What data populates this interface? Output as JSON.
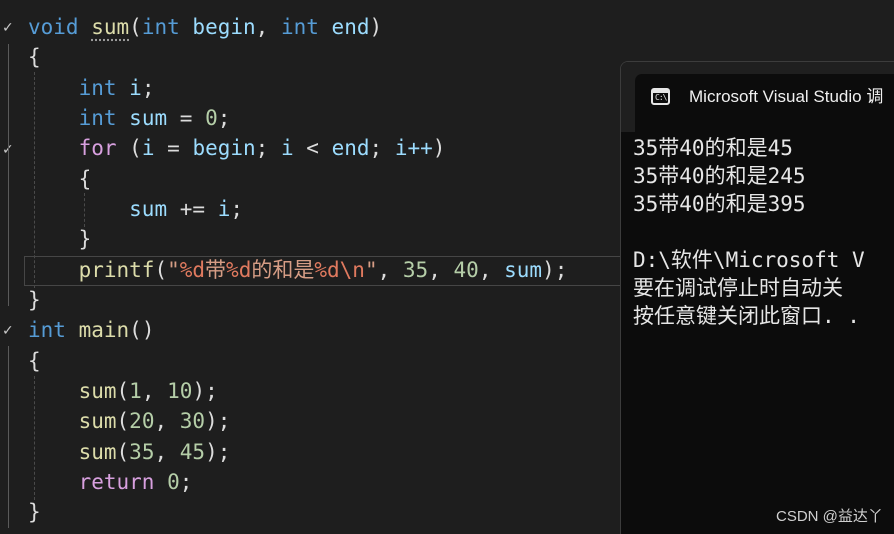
{
  "editor": {
    "lines": [
      {
        "t": "void sum(int begin, int end)"
      },
      {
        "t": "{"
      },
      {
        "t": "    int i;"
      },
      {
        "t": "    int sum = 0;"
      },
      {
        "t": "    for (i = begin; i < end; i++)"
      },
      {
        "t": "    {"
      },
      {
        "t": "        sum += i;"
      },
      {
        "t": "    }"
      },
      {
        "t": "    printf(\"%d带%d的和是%d\\n\", 35, 40, sum);"
      },
      {
        "t": "}"
      },
      {
        "t": "int main()"
      },
      {
        "t": "{"
      },
      {
        "t": "    sum(1, 10);"
      },
      {
        "t": "    sum(20, 30);"
      },
      {
        "t": "    sum(35, 45);"
      },
      {
        "t": "    return 0;"
      },
      {
        "t": "}"
      }
    ],
    "tokens": {
      "l0": [
        "void",
        "sum",
        "(",
        "int",
        "begin",
        ",",
        "int",
        "end",
        ")"
      ],
      "l1": [
        "{"
      ],
      "l2": [
        "int",
        "i",
        ";"
      ],
      "l3": [
        "int",
        "sum",
        "=",
        "0",
        ";"
      ],
      "l4": [
        "for",
        "(",
        "i",
        "=",
        "begin",
        ";",
        "i",
        "<",
        "end",
        ";",
        "i++",
        ")"
      ],
      "l5": [
        "{"
      ],
      "l6": [
        "sum",
        "+=",
        "i",
        ";"
      ],
      "l7": [
        "}"
      ],
      "l8": [
        "printf",
        "(",
        "\"",
        "%d",
        "带",
        "%d",
        "的和是",
        "%d",
        "\\n",
        "\"",
        ",",
        "35",
        ",",
        "40",
        ",",
        "sum",
        ");"
      ],
      "l9": [
        "}"
      ],
      "l10": [
        "int",
        "main",
        "()"
      ],
      "l11": [
        "{"
      ],
      "l12": [
        "sum",
        "(",
        "1",
        ",",
        "10",
        ");"
      ],
      "l13": [
        "sum",
        "(",
        "20",
        ",",
        "30",
        ");"
      ],
      "l14": [
        "sum",
        "(",
        "35",
        ",",
        "45",
        ");"
      ],
      "l15": [
        "return",
        "0",
        ";"
      ],
      "l16": [
        "}"
      ]
    }
  },
  "console": {
    "title": "Microsoft Visual Studio 调",
    "icon": "terminal-icon",
    "icon_glyph": "C:\\",
    "output_lines": [
      "35带40的和是45",
      "35带40的和是245",
      "35带40的和是395",
      "",
      "D:\\软件\\Microsoft V",
      "要在调试停止时自动关",
      "按任意键关闭此窗口. ."
    ]
  },
  "watermark": "CSDN @益达丫",
  "colors": {
    "background": "#1e1e1e",
    "keyword": "#569cd6",
    "control_keyword": "#d8a0df",
    "function": "#dcdcaa",
    "variable": "#9cdcfe",
    "number": "#b5cea8",
    "string": "#d69d85",
    "console_bg": "#0c0c0c"
  }
}
